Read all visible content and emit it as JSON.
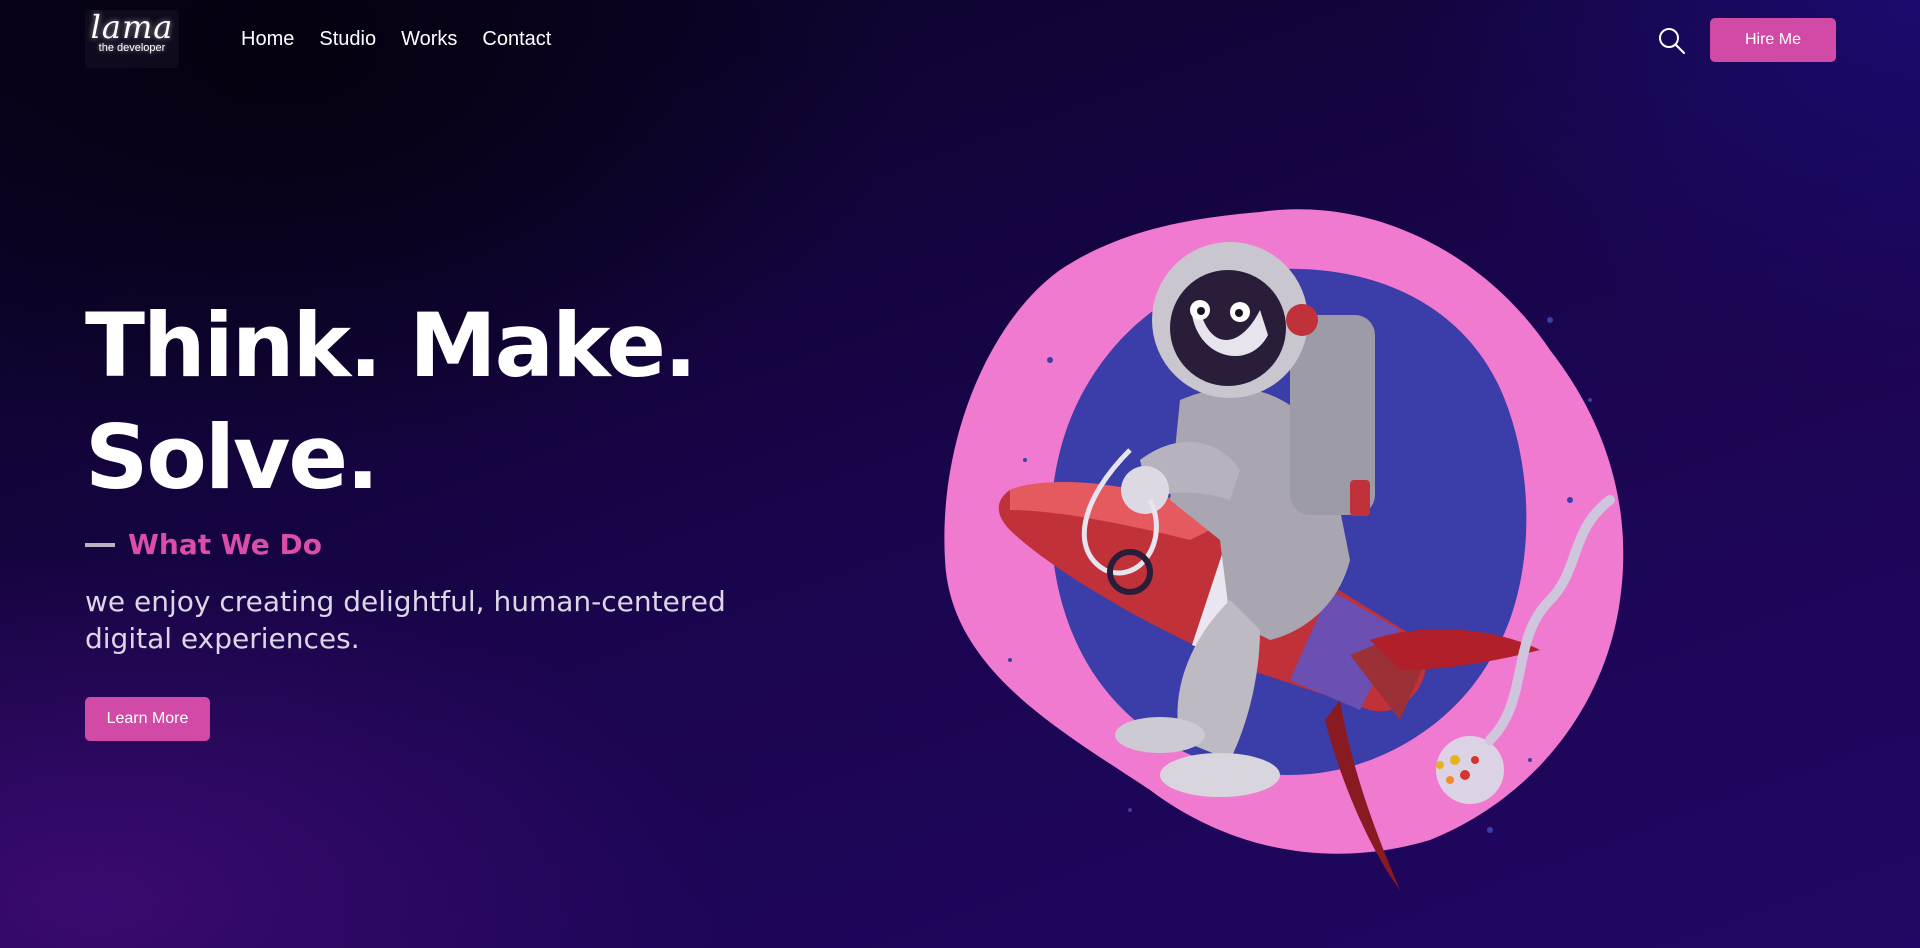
{
  "nav": {
    "logo": {
      "main": "lama",
      "sub": "the developer"
    },
    "links": [
      "Home",
      "Studio",
      "Works",
      "Contact"
    ],
    "search_icon": "search-icon",
    "hire_label": "Hire Me"
  },
  "hero": {
    "headline_line1": "Think. Make.",
    "headline_line2": "Solve.",
    "tagline": "What We Do",
    "description": "we enjoy creating delightful, human-centered digital experiences.",
    "cta_label": "Learn More"
  },
  "illustration": {
    "icon": "astronaut-riding-rocket-illustration"
  },
  "colors": {
    "accent": "#d14ba6",
    "tagline": "#da4ea8",
    "blob_pink": "#f07ad0",
    "blob_blue": "#3b3ea8",
    "background_dark": "#0a0320",
    "background_purple": "#210763"
  }
}
